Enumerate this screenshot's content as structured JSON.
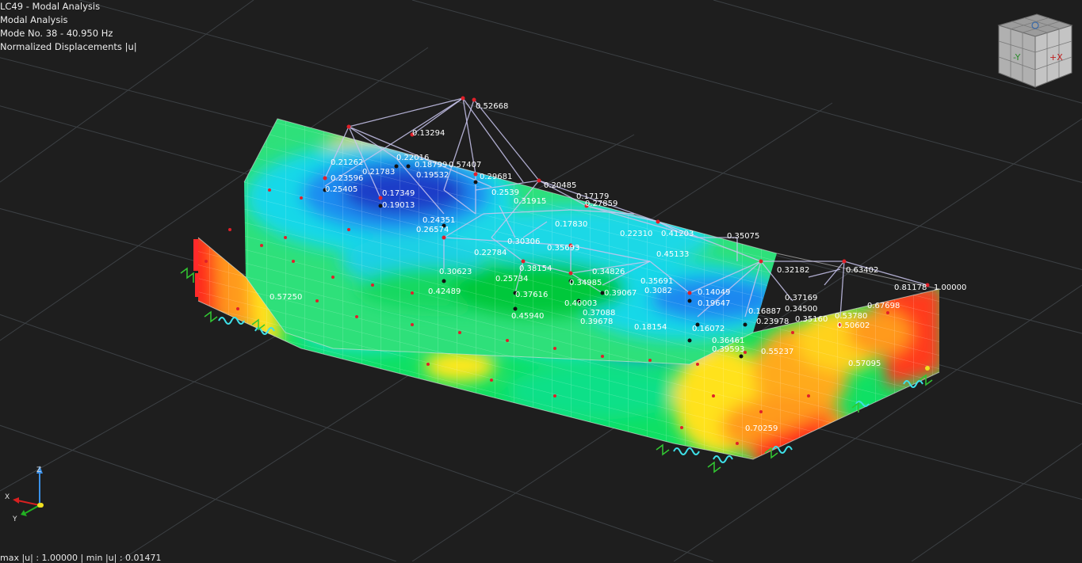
{
  "info": {
    "load_case": "LC49 - Modal Analysis",
    "analysis": "Modal Analysis",
    "mode": "Mode No. 38 - 40.950 Hz",
    "result": "Normalized Displacements |u|"
  },
  "status_bar": {
    "text": "max |u| : 1.00000 | min |u| : 0.01471"
  },
  "view_cube": {
    "face_y": "-Y",
    "face_x": "+X"
  },
  "axes": {
    "x": "X",
    "y": "Y",
    "z": "Z"
  },
  "colors": {
    "background": "#1e1e1e",
    "grid": "#3c4044",
    "truss": "#c9c6ee",
    "node": "#e0202a",
    "spring": "#3ee0e8",
    "support": "#32c832"
  },
  "values": [
    "0.52668",
    "0.13294",
    "0.21262",
    "0.22016",
    "0.18799",
    "0.57407",
    "0.21783",
    "0.19532",
    "0.29681",
    "0.23596",
    "0.25405",
    "0.17349",
    "0.19013",
    "0.20485",
    "0.17179",
    "0.2539",
    "0.31915",
    "0.27859",
    "0.24351",
    "0.26574",
    "0.17830",
    "0.22310",
    "0.41203",
    "0.35075",
    "0.45133",
    "0.30306",
    "0.22784",
    "0.35693",
    "0.38154",
    "0.30623",
    "0.25734",
    "0.34985",
    "0.34826",
    "0.35691",
    "0.32182",
    "0.63402",
    "0.81178",
    "1.00000",
    "0.57250",
    "0.42489",
    "0.37616",
    "0.39067",
    "0.3082",
    "0.14049",
    "0.19647",
    "0.37169",
    "0.40003",
    "0.37088",
    "0.45940",
    "0.39678",
    "0.18154",
    "0.16072",
    "0.16887",
    "0.34500",
    "0.23978",
    "0.35160",
    "0.53780",
    "0.67698",
    "0.50602",
    "0.36461",
    "0.39593",
    "0.55237",
    "0.57095",
    "0.70259"
  ]
}
